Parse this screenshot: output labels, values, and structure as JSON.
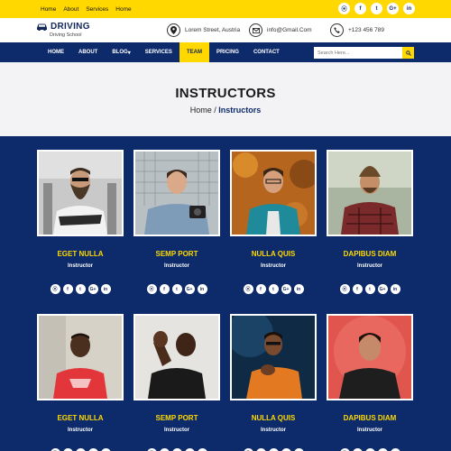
{
  "topbar": {
    "links": [
      "Home",
      "About",
      "Services",
      "Home"
    ],
    "social_icons": [
      "rss-icon",
      "facebook-icon",
      "twitter-icon",
      "google-plus-icon",
      "linkedin-icon"
    ],
    "social_glyphs": [
      "⦿",
      "f",
      "t",
      "G+",
      "in"
    ]
  },
  "header": {
    "logo_title": "DRIVING",
    "logo_subtitle": "Driving School",
    "address": "Lorem Street, Austria",
    "email": "info@Gmail.Com",
    "phone": "+123 456 789"
  },
  "nav": {
    "items": [
      "HOME",
      "ABOUT",
      "BLOG",
      "SERVICES",
      "TEAM",
      "PRICING",
      "CONTACT"
    ],
    "blog_caret": "▾",
    "active_index": 4,
    "search_placeholder": "Search Here..."
  },
  "banner": {
    "title": "INSTRUCTORS",
    "crumb_home": "Home",
    "crumb_sep": "/",
    "crumb_current": "Instructors"
  },
  "team": {
    "members": [
      {
        "name": "EGET NULLA",
        "role": "Instructor"
      },
      {
        "name": "SEMP PORT",
        "role": "Instructor"
      },
      {
        "name": "NULLA QUIS",
        "role": "Instructor"
      },
      {
        "name": "DAPIBUS DIAM",
        "role": "Instructor"
      },
      {
        "name": "EGET NULLA",
        "role": "Instructor"
      },
      {
        "name": "SEMP PORT",
        "role": "Instructor"
      },
      {
        "name": "NULLA QUIS",
        "role": "Instructor"
      },
      {
        "name": "DAPIBUS DIAM",
        "role": "Instructor"
      }
    ]
  },
  "colors": {
    "accent": "#ffd800",
    "primary": "#0d2b6b",
    "banner_bg": "#f3f3f5"
  }
}
